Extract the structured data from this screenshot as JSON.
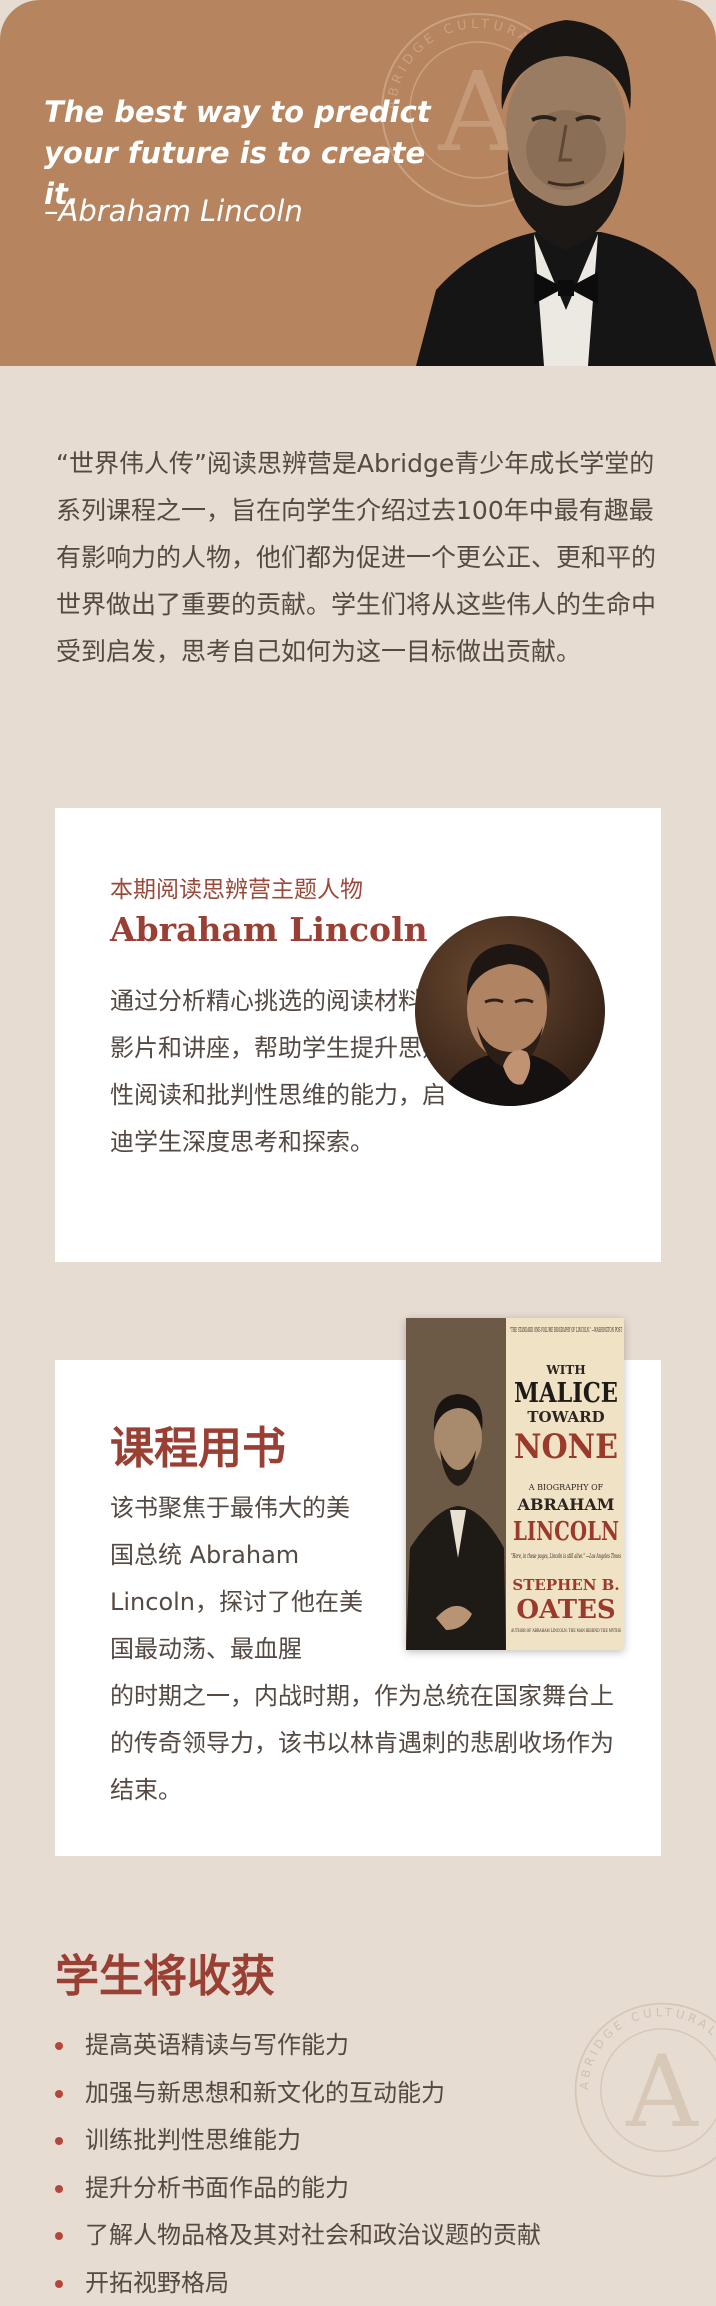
{
  "hero": {
    "quote": "The best way to predict your future is to create it.",
    "author": "–Abraham Lincoln",
    "seal_text": "ABRIDGE CULTURAL CONSULTING",
    "seal_letter": "A",
    "background": "#b6845f"
  },
  "intro": {
    "text": "“世界伟人传”阅读思辨营是Abridge青少年成长学堂的系列课程之一，旨在向学生介绍过去100年中最有趣最有影响力的人物，他们都为促进一个更公正、更和平的世界做出了重要的贡献。学生们将从这些伟人的生命中受到启发，思考自己如何为这一目标做出贡献。"
  },
  "theme_card": {
    "eyebrow": "本期阅读思辨营主题人物",
    "title": "Abraham Lincoln",
    "text": "通过分析精心挑选的阅读材料、影片和讲座，帮助学生提升思辨性阅读和批判性思维的能力，启迪学生深度思考和探索。"
  },
  "book_card": {
    "title": "课程用书",
    "text_narrow": "该书聚焦于最伟大的美国总统 Abraham Lincoln，探讨了他在美国最动荡、最血腥",
    "text_wide": "的时期之一，内战时期，作为总统在国家舞台上的传奇领导力，该书以林肯遇刺的悲剧收场作为结束。",
    "book_cover": {
      "blurb_top": "\"THE STANDARD ONE-VOLUME BIOGRAPHY OF LINCOLN.\" —WASHINGTON POST",
      "title_1": "WITH",
      "title_2": "MALICE",
      "title_3": "TOWARD",
      "title_4": "NONE",
      "subtitle": "A BIOGRAPHY OF",
      "name_1": "ABRAHAM",
      "name_2": "LINCOLN",
      "quote": "\"Here, in these pages, Lincoln is still alive.\" —Los Angeles Times",
      "author_1": "STEPHEN B.",
      "author_2": "OATES",
      "author_note": "AUTHOR OF ABRAHAM LINCOLN: THE MAN BEHIND THE MYTHS"
    }
  },
  "gains": {
    "title": "学生将收获",
    "items": [
      "提高英语精读与写作能力",
      "加强与新思想和新文化的互动能力",
      "训练批判性思维能力",
      "提升分析书面作品的能力",
      "了解人物品格及其对社会和政治议题的贡献",
      "开拓视野格局"
    ]
  },
  "colors": {
    "page_bg": "#e6dcd2",
    "accent_red": "#9a3f33",
    "text": "#554a43"
  }
}
